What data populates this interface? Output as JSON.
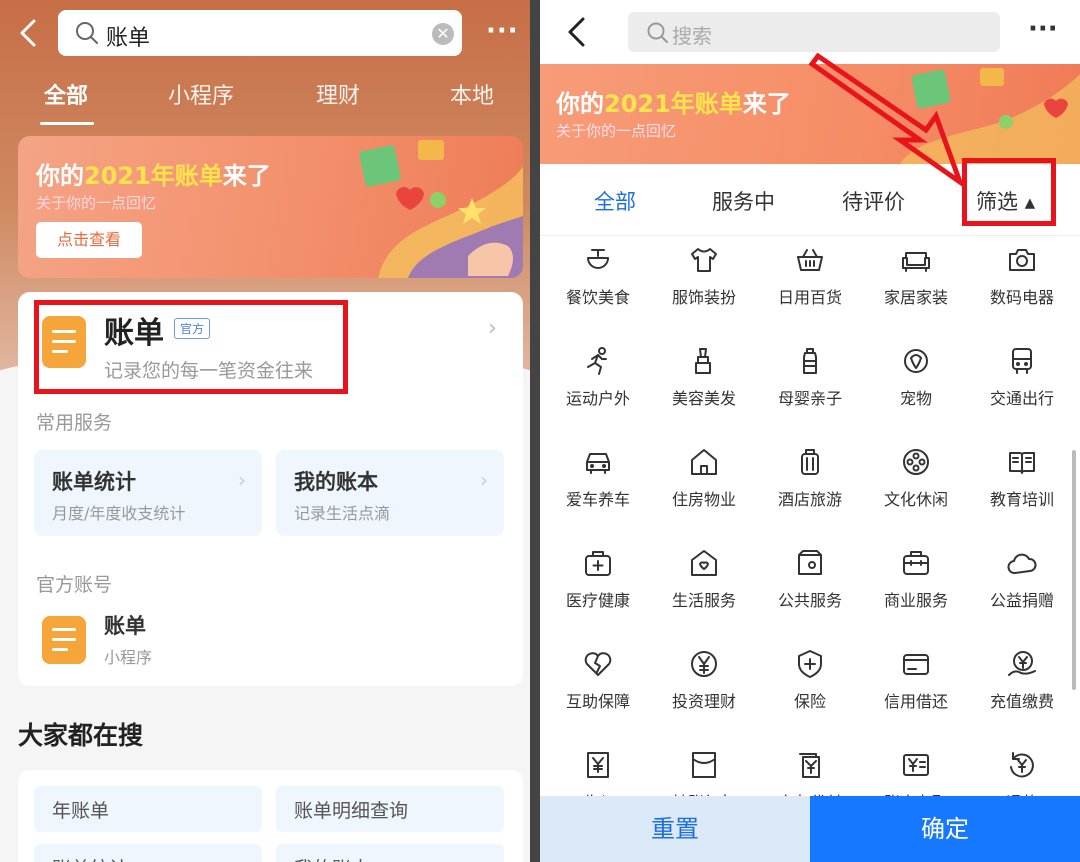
{
  "left": {
    "search": {
      "value": "账单"
    },
    "tabs": [
      "全部",
      "小程序",
      "理财",
      "本地"
    ],
    "banner": {
      "title_pre": "你的",
      "title_year": "2021年账单",
      "title_post": "来了",
      "subtitle": "关于你的一点回忆",
      "button": "点击查看"
    },
    "card": {
      "name": "账单",
      "badge": "官方",
      "desc": "记录您的每一笔资金往来",
      "section_services": "常用服务",
      "services": [
        {
          "title": "账单统计",
          "desc": "月度/年度收支统计"
        },
        {
          "title": "我的账本",
          "desc": "记录生活点滴"
        }
      ],
      "section_official": "官方账号",
      "official": {
        "name": "账单",
        "type": "小程序"
      }
    },
    "hot_title": "大家都在搜",
    "hot": [
      "年账单",
      "账单明细查询",
      "账单统计",
      "我的账本"
    ]
  },
  "right": {
    "search": {
      "placeholder": "搜索"
    },
    "banner": {
      "title_pre": "你的",
      "title_year": "2021年账单",
      "title_post": "来了",
      "subtitle": "关于你的一点回忆"
    },
    "tabs": [
      "全部",
      "服务中",
      "待评价",
      "筛选 ▴"
    ],
    "categories": [
      {
        "label": "餐饮美食",
        "icon": "bowl-icon"
      },
      {
        "label": "服饰装扮",
        "icon": "shirt-icon"
      },
      {
        "label": "日用百货",
        "icon": "basket-icon"
      },
      {
        "label": "家居家装",
        "icon": "sofa-icon"
      },
      {
        "label": "数码电器",
        "icon": "camera-icon"
      },
      {
        "label": "运动户外",
        "icon": "runner-icon"
      },
      {
        "label": "美容美发",
        "icon": "lipstick-icon"
      },
      {
        "label": "母婴亲子",
        "icon": "baby-bottle-icon"
      },
      {
        "label": "宠物",
        "icon": "pet-icon"
      },
      {
        "label": "交通出行",
        "icon": "bus-icon"
      },
      {
        "label": "爱车养车",
        "icon": "car-icon"
      },
      {
        "label": "住房物业",
        "icon": "house-icon"
      },
      {
        "label": "酒店旅游",
        "icon": "luggage-icon"
      },
      {
        "label": "文化休闲",
        "icon": "film-reel-icon"
      },
      {
        "label": "教育培训",
        "icon": "book-icon"
      },
      {
        "label": "医疗健康",
        "icon": "medkit-icon"
      },
      {
        "label": "生活服务",
        "icon": "heart-house-icon"
      },
      {
        "label": "公共服务",
        "icon": "wallet-icon"
      },
      {
        "label": "商业服务",
        "icon": "briefcase-icon"
      },
      {
        "label": "公益捐赠",
        "icon": "cloud-icon"
      },
      {
        "label": "互助保障",
        "icon": "broken-heart-icon"
      },
      {
        "label": "投资理财",
        "icon": "yen-coin-icon"
      },
      {
        "label": "保险",
        "icon": "shield-icon"
      },
      {
        "label": "信用借还",
        "icon": "card-icon"
      },
      {
        "label": "充值缴费",
        "icon": "recharge-icon"
      },
      {
        "label": "收入",
        "icon": "yen-doc-icon"
      },
      {
        "label": "转账红包",
        "icon": "envelope-icon"
      },
      {
        "label": "亲友代付",
        "icon": "yen-stack-icon"
      },
      {
        "label": "账户存取",
        "icon": "yen-box-icon"
      },
      {
        "label": "退款",
        "icon": "refund-icon"
      }
    ],
    "footer": {
      "reset": "重置",
      "confirm": "确定"
    }
  }
}
